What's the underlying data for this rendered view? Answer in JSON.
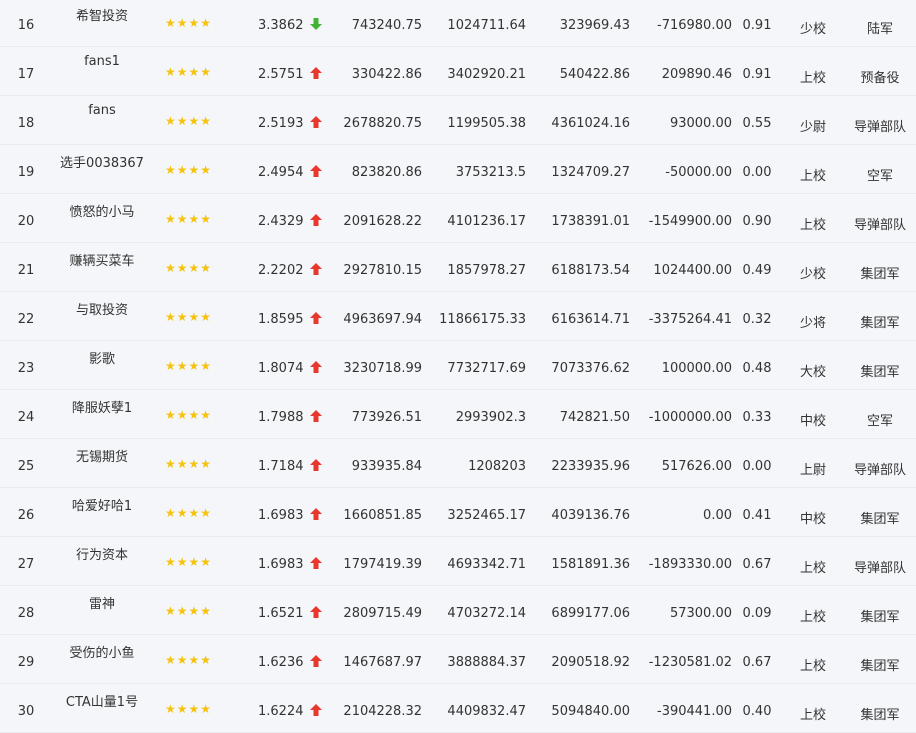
{
  "icons": {
    "star": "star-icon",
    "up": "arrow-up-icon",
    "down": "arrow-down-icon"
  },
  "colors": {
    "star": "#f5c30f",
    "up": "#e8372d",
    "down": "#43b335"
  },
  "rows": [
    {
      "rank": "16",
      "name": "希智投资",
      "stars": 4,
      "score": "3.3862",
      "trend": "down",
      "v1": "743240.75",
      "v2": "1024711.64",
      "v3": "323969.43",
      "v4": "-716980.00",
      "ratio": "0.91",
      "title": "少校",
      "unit": "陆军"
    },
    {
      "rank": "17",
      "name": "fans1",
      "stars": 4,
      "score": "2.5751",
      "trend": "up",
      "v1": "330422.86",
      "v2": "3402920.21",
      "v3": "540422.86",
      "v4": "209890.46",
      "ratio": "0.91",
      "title": "上校",
      "unit": "预备役"
    },
    {
      "rank": "18",
      "name": "fans",
      "stars": 4,
      "score": "2.5193",
      "trend": "up",
      "v1": "2678820.75",
      "v2": "1199505.38",
      "v3": "4361024.16",
      "v4": "93000.00",
      "ratio": "0.55",
      "title": "少尉",
      "unit": "导弹部队"
    },
    {
      "rank": "19",
      "name": "选手0038367",
      "stars": 4,
      "score": "2.4954",
      "trend": "up",
      "v1": "823820.86",
      "v2": "3753213.5",
      "v3": "1324709.27",
      "v4": "-50000.00",
      "ratio": "0.00",
      "title": "上校",
      "unit": "空军"
    },
    {
      "rank": "20",
      "name": "愤怒的小马",
      "stars": 4,
      "score": "2.4329",
      "trend": "up",
      "v1": "2091628.22",
      "v2": "4101236.17",
      "v3": "1738391.01",
      "v4": "-1549900.00",
      "ratio": "0.90",
      "title": "上校",
      "unit": "导弹部队"
    },
    {
      "rank": "21",
      "name": "赚辆买菜车",
      "stars": 4,
      "score": "2.2202",
      "trend": "up",
      "v1": "2927810.15",
      "v2": "1857978.27",
      "v3": "6188173.54",
      "v4": "1024400.00",
      "ratio": "0.49",
      "title": "少校",
      "unit": "集团军"
    },
    {
      "rank": "22",
      "name": "与取投资",
      "stars": 4,
      "score": "1.8595",
      "trend": "up",
      "v1": "4963697.94",
      "v2": "11866175.33",
      "v3": "6163614.71",
      "v4": "-3375264.41",
      "ratio": "0.32",
      "title": "少将",
      "unit": "集团军"
    },
    {
      "rank": "23",
      "name": "影歌",
      "stars": 4,
      "score": "1.8074",
      "trend": "up",
      "v1": "3230718.99",
      "v2": "7732717.69",
      "v3": "7073376.62",
      "v4": "100000.00",
      "ratio": "0.48",
      "title": "大校",
      "unit": "集团军"
    },
    {
      "rank": "24",
      "name": "降服妖孽1",
      "stars": 4,
      "score": "1.7988",
      "trend": "up",
      "v1": "773926.51",
      "v2": "2993902.3",
      "v3": "742821.50",
      "v4": "-1000000.00",
      "ratio": "0.33",
      "title": "中校",
      "unit": "空军"
    },
    {
      "rank": "25",
      "name": "无锡期货",
      "stars": 4,
      "score": "1.7184",
      "trend": "up",
      "v1": "933935.84",
      "v2": "1208203",
      "v3": "2233935.96",
      "v4": "517626.00",
      "ratio": "0.00",
      "title": "上尉",
      "unit": "导弹部队"
    },
    {
      "rank": "26",
      "name": "哈爱好哈1",
      "stars": 4,
      "score": "1.6983",
      "trend": "up",
      "v1": "1660851.85",
      "v2": "3252465.17",
      "v3": "4039136.76",
      "v4": "0.00",
      "ratio": "0.41",
      "title": "中校",
      "unit": "集团军"
    },
    {
      "rank": "27",
      "name": "行为资本",
      "stars": 4,
      "score": "1.6983",
      "trend": "up",
      "v1": "1797419.39",
      "v2": "4693342.71",
      "v3": "1581891.36",
      "v4": "-1893330.00",
      "ratio": "0.67",
      "title": "上校",
      "unit": "导弹部队"
    },
    {
      "rank": "28",
      "name": "雷神",
      "stars": 4,
      "score": "1.6521",
      "trend": "up",
      "v1": "2809715.49",
      "v2": "4703272.14",
      "v3": "6899177.06",
      "v4": "57300.00",
      "ratio": "0.09",
      "title": "上校",
      "unit": "集团军"
    },
    {
      "rank": "29",
      "name": "受伤的小鱼",
      "stars": 4,
      "score": "1.6236",
      "trend": "up",
      "v1": "1467687.97",
      "v2": "3888884.37",
      "v3": "2090518.92",
      "v4": "-1230581.02",
      "ratio": "0.67",
      "title": "上校",
      "unit": "集团军"
    },
    {
      "rank": "30",
      "name": "CTA山量1号",
      "stars": 4,
      "score": "1.6224",
      "trend": "up",
      "v1": "2104228.32",
      "v2": "4409832.47",
      "v3": "5094840.00",
      "v4": "-390441.00",
      "ratio": "0.40",
      "title": "上校",
      "unit": "集团军"
    }
  ]
}
